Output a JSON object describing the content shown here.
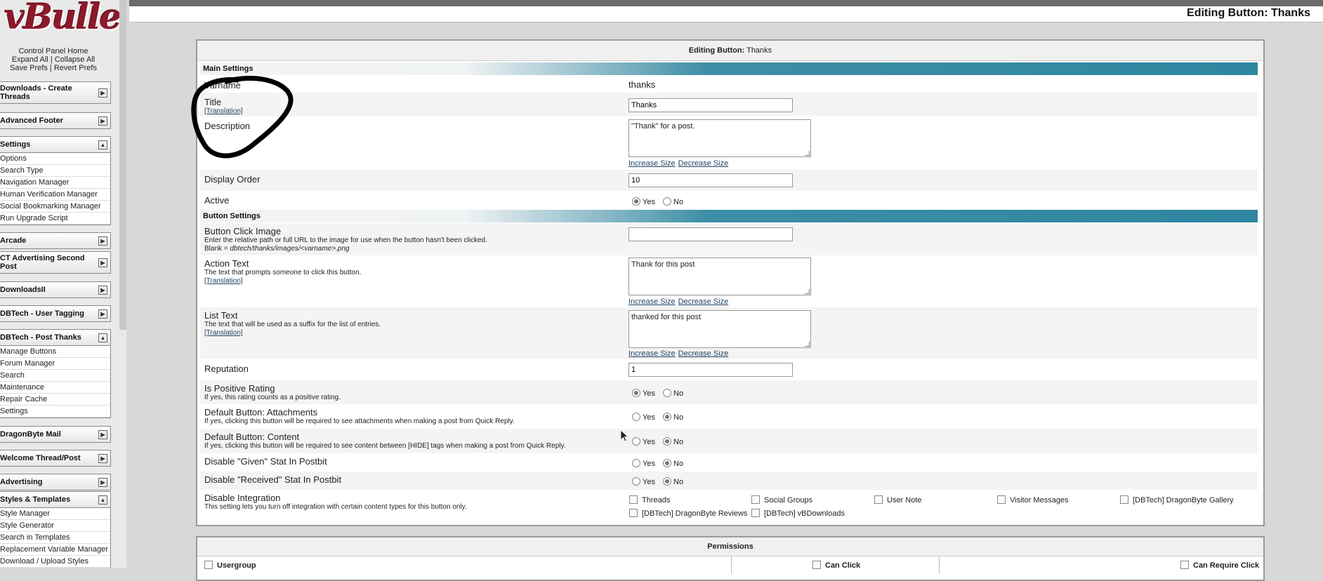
{
  "sidebar": {
    "logo_text": "vBulletin",
    "links": {
      "control_panel_home": "Control Panel Home",
      "expand_all": "Expand All",
      "collapse_all": "Collapse All",
      "save_prefs": "Save Prefs",
      "revert_prefs": "Revert Prefs",
      "separator": "|"
    },
    "groups": [
      {
        "title": "Downloads - Create Threads",
        "items": []
      },
      {
        "title": "Advanced Footer",
        "items": []
      },
      {
        "title": "Settings",
        "items": [
          "Options",
          "Search Type",
          "Navigation Manager",
          "Human Verification Manager",
          "Social Bookmarking Manager",
          "Run Upgrade Script"
        ]
      },
      {
        "title": "Arcade",
        "items": []
      },
      {
        "title": "CT Advertising Second Post",
        "items": []
      },
      {
        "title": "DownloadsII",
        "items": []
      },
      {
        "title": "DBTech - User Tagging",
        "items": []
      },
      {
        "title": "DBTech - Post Thanks",
        "items": [
          "Manage Buttons",
          "Forum Manager",
          "Search",
          "Maintenance",
          "Repair Cache",
          "Settings"
        ]
      },
      {
        "title": "DragonByte Mail",
        "items": []
      },
      {
        "title": "Welcome Thread/Post",
        "items": []
      },
      {
        "title": "Advertising",
        "items": []
      },
      {
        "title": "Styles & Templates",
        "items": [
          "Style Manager",
          "Style Generator",
          "Search in Templates",
          "Replacement Variable Manager",
          "Download / Upload Styles"
        ]
      }
    ]
  },
  "header": {
    "page_title": "Editing Button: Thanks"
  },
  "form": {
    "title_prefix": "Editing Button:",
    "title_name": "Thanks",
    "sections": {
      "main": "Main Settings",
      "button": "Button Settings"
    },
    "translation_link": "[Translation]",
    "increase_size": "Increase Size",
    "decrease_size": "Decrease Size",
    "yes": "Yes",
    "no": "No",
    "varname": {
      "label": "Varname",
      "value": "thanks"
    },
    "title": {
      "label": "Title",
      "value": "Thanks"
    },
    "description": {
      "label": "Description",
      "value": "\"Thank\" for a post."
    },
    "display_order": {
      "label": "Display Order",
      "value": "10"
    },
    "active": {
      "label": "Active",
      "selected": "Yes"
    },
    "button_click_image": {
      "label": "Button Click Image",
      "desc": "Enter the relative path or full URL to the image for use when the button hasn't been clicked.",
      "blank_prefix": "Blank =",
      "blank_value": "dbtech/thanks/images/<varname>.png",
      "value": ""
    },
    "action_text": {
      "label": "Action Text",
      "desc": "The text that prompts someone to click this button.",
      "value": "Thank for this post"
    },
    "list_text": {
      "label": "List Text",
      "desc": "The text that will be used as a suffix for the list of entries.",
      "value": "thanked for this post"
    },
    "reputation": {
      "label": "Reputation",
      "value": "1"
    },
    "is_positive": {
      "label": "Is Positive Rating",
      "desc": "If yes, this rating counts as a positive rating.",
      "selected": "Yes"
    },
    "default_attachments": {
      "label": "Default Button: Attachments",
      "desc": "If yes, clicking this button will be required to see attachments when making a post from Quick Reply.",
      "selected": "No"
    },
    "default_content": {
      "label": "Default Button: Content",
      "desc": "If yes, clicking this button will be required to see content between [HIDE] tags when making a post from Quick Reply.",
      "selected": "No"
    },
    "disable_given": {
      "label": "Disable \"Given\" Stat In Postbit",
      "selected": "No"
    },
    "disable_received": {
      "label": "Disable \"Received\" Stat In Postbit",
      "selected": "No"
    },
    "disable_integration": {
      "label": "Disable Integration",
      "desc": "This setting lets you turn off integration with certain content types for this button only.",
      "options": [
        "Threads",
        "Social Groups",
        "User Note",
        "Visitor Messages",
        "[DBTech] DragonByte Gallery",
        "[DBTech] DragonByte Reviews",
        "[DBTech] vBDownloads"
      ]
    }
  },
  "permissions": {
    "title": "Permissions",
    "columns": [
      "Usergroup",
      "Can Click",
      "Can Require Click"
    ]
  },
  "colors": {
    "section_bar": "#2f86a0",
    "annotation": "#000000",
    "logo": "#8c1a2b"
  }
}
